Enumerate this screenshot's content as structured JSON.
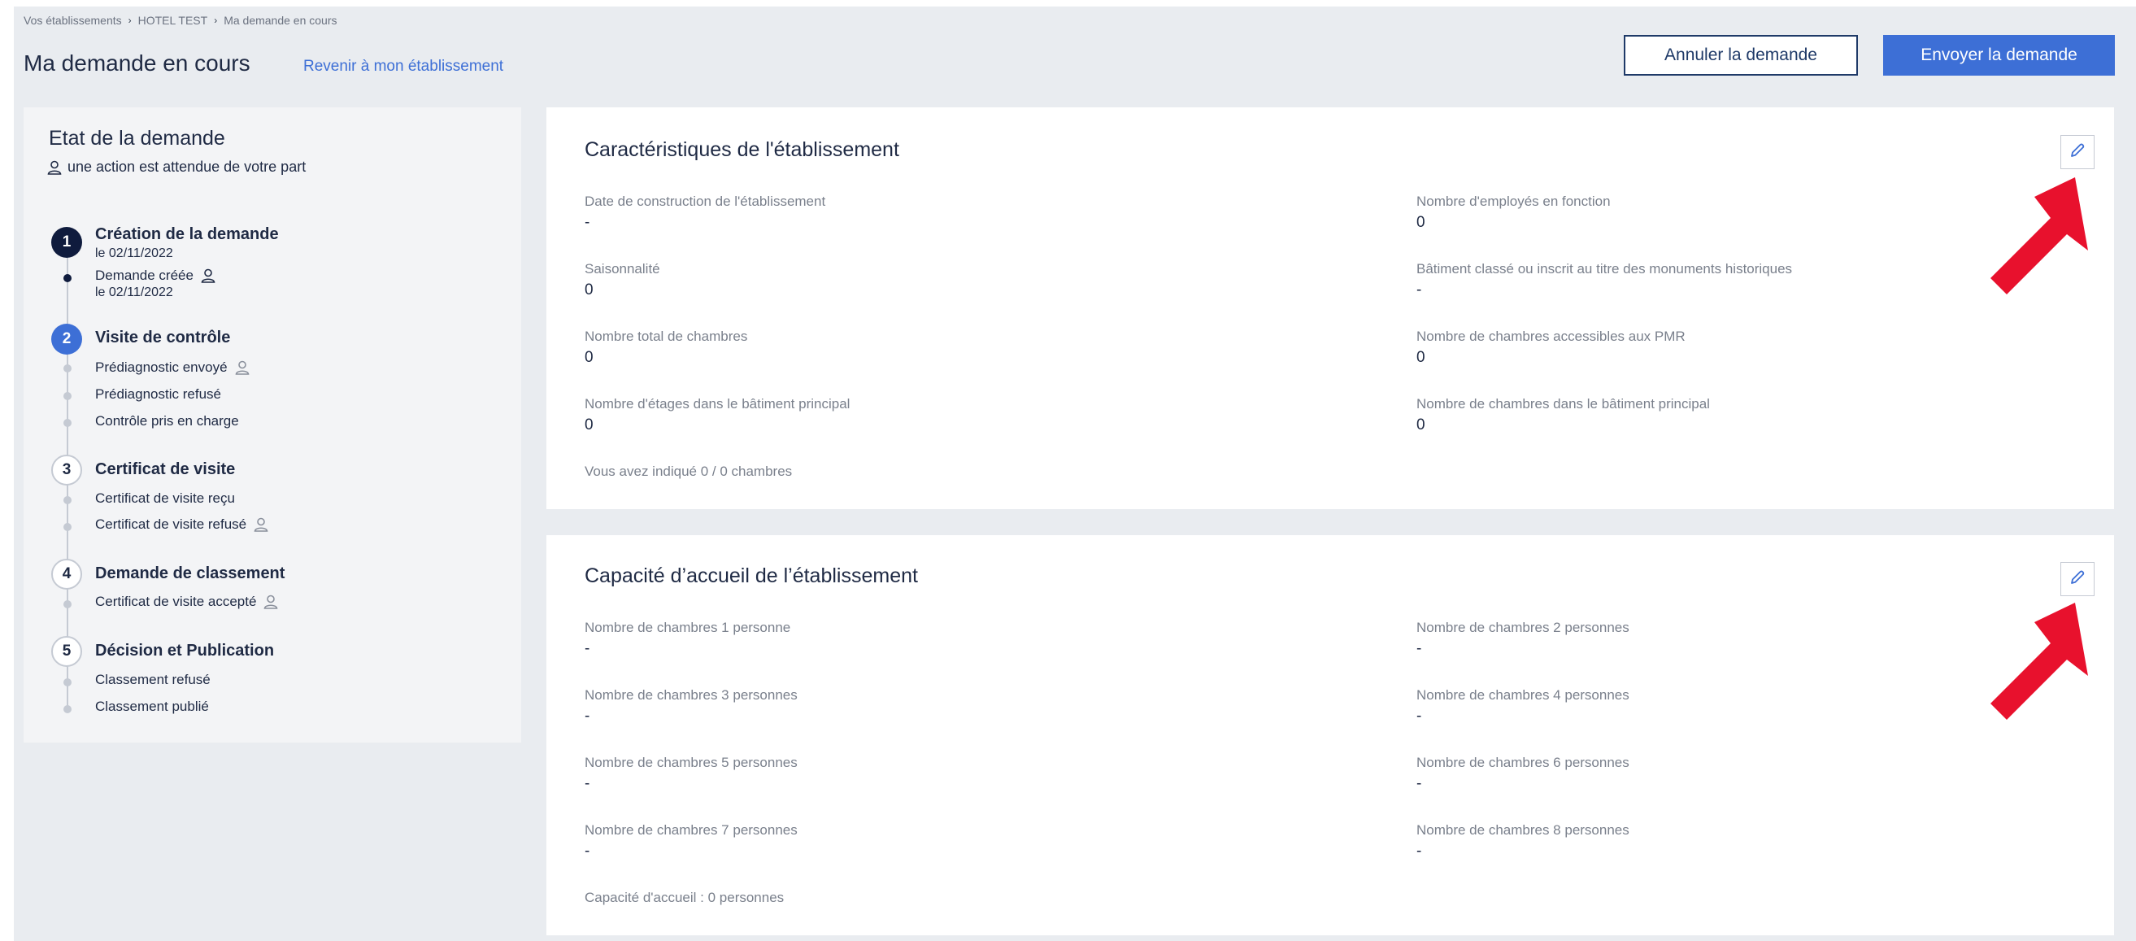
{
  "breadcrumb": {
    "item1": "Vos établissements",
    "item2": "HOTEL TEST",
    "item3": "Ma demande en cours",
    "separator": "›"
  },
  "header": {
    "title": "Ma demande en cours",
    "back_link": "Revenir à mon établissement",
    "cancel_button": "Annuler la demande",
    "send_button": "Envoyer la demande"
  },
  "status": {
    "title": "Etat de la demande",
    "subtitle": "une action est attendue de votre part",
    "steps": [
      {
        "number": "1",
        "title": "Création de la demande",
        "date": "le 02/11/2022"
      },
      {
        "number": "2",
        "title": "Visite de contrôle"
      },
      {
        "number": "3",
        "title": "Certificat de visite"
      },
      {
        "number": "4",
        "title": "Demande de classement"
      },
      {
        "number": "5",
        "title": "Décision et Publication"
      }
    ],
    "sub": {
      "demande_creee": "Demande créée",
      "demande_creee_date": "le 02/11/2022",
      "prediag_envoye": "Prédiagnostic envoyé",
      "prediag_refuse": "Prédiagnostic refusé",
      "controle_pris": "Contrôle pris en charge",
      "certif_recu": "Certificat de visite reçu",
      "certif_refuse": "Certificat de visite refusé",
      "certif_accepte": "Certificat de visite accepté",
      "classement_refuse": "Classement refusé",
      "classement_publie": "Classement publié"
    }
  },
  "caracteristiques": {
    "title": "Caractéristiques de l'établissement",
    "fields": [
      {
        "label": "Date de construction de l'établissement",
        "value": "-"
      },
      {
        "label": "Nombre d'employés en fonction",
        "value": "0"
      },
      {
        "label": "Saisonnalité",
        "value": "0"
      },
      {
        "label": "Bâtiment classé ou inscrit au titre des monuments historiques",
        "value": "-"
      },
      {
        "label": "Nombre total de chambres",
        "value": "0"
      },
      {
        "label": "Nombre de chambres accessibles aux PMR",
        "value": "0"
      },
      {
        "label": "Nombre d'étages dans le bâtiment principal",
        "value": "0"
      },
      {
        "label": "Nombre de chambres dans le bâtiment principal",
        "value": "0"
      }
    ],
    "summary": "Vous avez indiqué 0 / 0 chambres"
  },
  "capacite": {
    "title": "Capacité d’accueil de l’établissement",
    "fields": [
      {
        "label": "Nombre de chambres 1 personne",
        "value": "-"
      },
      {
        "label": "Nombre de chambres 2 personnes",
        "value": "-"
      },
      {
        "label": "Nombre de chambres 3 personnes",
        "value": "-"
      },
      {
        "label": "Nombre de chambres 4 personnes",
        "value": "-"
      },
      {
        "label": "Nombre de chambres 5 personnes",
        "value": "-"
      },
      {
        "label": "Nombre de chambres 6 personnes",
        "value": "-"
      },
      {
        "label": "Nombre de chambres 7 personnes",
        "value": "-"
      },
      {
        "label": "Nombre de chambres 8 personnes",
        "value": "-"
      }
    ],
    "summary": "Capacité d'accueil : 0 personnes"
  },
  "colors": {
    "accent": "#3d6fd6",
    "navy": "#0f1b3d",
    "arrow": "#e8112d",
    "background": "#e9ecf0"
  },
  "icons": {
    "person": "person-outline-icon",
    "edit": "pencil-icon",
    "annotation": "red-arrow-icon"
  }
}
